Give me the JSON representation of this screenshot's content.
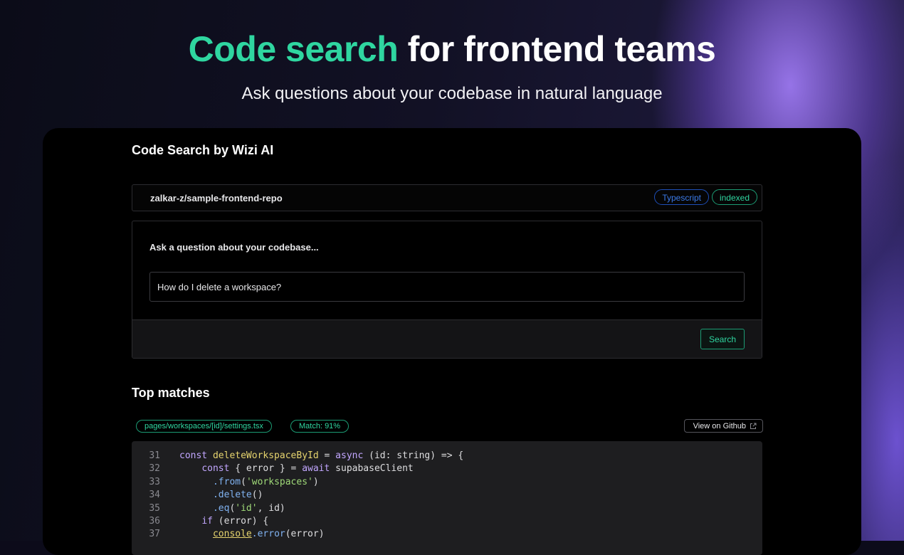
{
  "hero": {
    "title_accent": "Code search",
    "title_rest": "for frontend teams",
    "subtitle": "Ask questions about your codebase in natural language"
  },
  "panel": {
    "title": "Code Search by Wizi AI"
  },
  "repo": {
    "name": "zalkar-z/sample-frontend-repo",
    "language_tag": "Typescript",
    "status_tag": "indexed"
  },
  "ask": {
    "label": "Ask a question about your codebase...",
    "input_value": "How do I delete a workspace?",
    "search_label": "Search"
  },
  "matches": {
    "title": "Top matches",
    "file_path": "pages/workspaces/[id]/settings.tsx",
    "match_score": "Match: 91%",
    "github_label": "View on Github"
  },
  "code": {
    "lines": [
      {
        "num": "31",
        "indent": "",
        "tokens": [
          [
            "k",
            "const "
          ],
          [
            "fn",
            "deleteWorkspaceById"
          ],
          [
            "p",
            " = "
          ],
          [
            "k",
            "async"
          ],
          [
            "p",
            " (id: string) => {"
          ]
        ]
      },
      {
        "num": "32",
        "indent": "    ",
        "tokens": [
          [
            "k",
            "const"
          ],
          [
            "p",
            " { error } = "
          ],
          [
            "k",
            "await"
          ],
          [
            "p",
            " supabaseClient"
          ]
        ]
      },
      {
        "num": "33",
        "indent": "      ",
        "tokens": [
          [
            "m",
            ".from"
          ],
          [
            "p",
            "("
          ],
          [
            "s",
            "'workspaces'"
          ],
          [
            "p",
            ")"
          ]
        ]
      },
      {
        "num": "34",
        "indent": "      ",
        "tokens": [
          [
            "m",
            ".delete"
          ],
          [
            "p",
            "()"
          ]
        ]
      },
      {
        "num": "35",
        "indent": "      ",
        "tokens": [
          [
            "m",
            ".eq"
          ],
          [
            "p",
            "("
          ],
          [
            "s",
            "'id'"
          ],
          [
            "p",
            ", id)"
          ]
        ]
      },
      {
        "num": "36",
        "indent": "    ",
        "tokens": [
          [
            "k",
            "if"
          ],
          [
            "p",
            " (error) {"
          ]
        ]
      },
      {
        "num": "37",
        "indent": "      ",
        "tokens": [
          [
            "u",
            "console"
          ],
          [
            "m",
            ".error"
          ],
          [
            "p",
            "(error)"
          ]
        ]
      }
    ]
  },
  "colors": {
    "accent_green": "#2fd6a0",
    "tag_blue": "#3b7ae8",
    "panel_bg": "#000000"
  }
}
